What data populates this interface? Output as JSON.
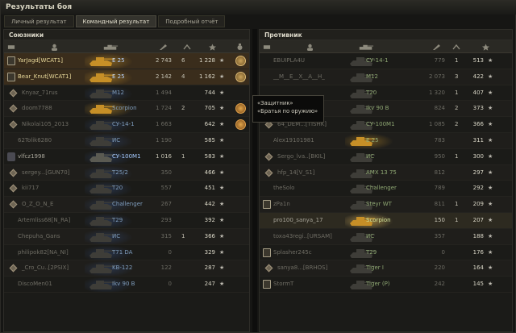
{
  "window": {
    "title": "Результаты боя"
  },
  "tabs": [
    {
      "label": "Личный результат",
      "active": false
    },
    {
      "label": "Командный результат",
      "active": true
    },
    {
      "label": "Подробный отчёт",
      "active": false
    }
  ],
  "allies": {
    "title": "Союзники",
    "rows": [
      {
        "name": "YarJagd[WCAT1]",
        "tank": "E 25",
        "dmg": "2 743",
        "kills": "6",
        "xp": "1 228",
        "mark": "platoon",
        "state": "me",
        "medal": "gear"
      },
      {
        "name": "Bear_Knut[WCAT1]",
        "tank": "E 25",
        "dmg": "2 142",
        "kills": "4",
        "xp": "1 162",
        "mark": "platoon",
        "state": "me",
        "medal": "gear"
      },
      {
        "name": "Knyaz_71rus",
        "tank": "M12",
        "dmg": "1 494",
        "kills": "",
        "xp": "744",
        "mark": "diamond",
        "state": "dead",
        "medal": ""
      },
      {
        "name": "doom7788",
        "tank": "Scorpion",
        "dmg": "1 724",
        "kills": "2",
        "xp": "705",
        "mark": "diamond",
        "state": "dead",
        "medal": "sun"
      },
      {
        "name": "Nikolai105_2013",
        "tank": "СУ-14-1",
        "dmg": "1 663",
        "kills": "",
        "xp": "642",
        "mark": "diamond",
        "state": "dead",
        "medal": "sun"
      },
      {
        "name": "62Tolik6280",
        "tank": "ИС",
        "dmg": "1 190",
        "kills": "",
        "xp": "585",
        "mark": "",
        "state": "dead",
        "medal": ""
      },
      {
        "name": "vlfcz1998",
        "tank": "СУ-100М1",
        "dmg": "1 016",
        "kills": "1",
        "xp": "583",
        "mark": "clan",
        "state": "alive",
        "medal": ""
      },
      {
        "name": "sergey...[GUN70]",
        "tank": "T25/2",
        "dmg": "350",
        "kills": "",
        "xp": "466",
        "mark": "diamond",
        "state": "dead",
        "medal": ""
      },
      {
        "name": "kii717",
        "tank": "T20",
        "dmg": "557",
        "kills": "",
        "xp": "451",
        "mark": "diamond",
        "state": "dead",
        "medal": ""
      },
      {
        "name": "O_Z_O_N_E",
        "tank": "Challenger",
        "dmg": "267",
        "kills": "",
        "xp": "442",
        "mark": "diamond",
        "state": "dead",
        "medal": ""
      },
      {
        "name": "Artemliss68[N_RA]",
        "tank": "T29",
        "dmg": "293",
        "kills": "",
        "xp": "392",
        "mark": "",
        "state": "dead",
        "medal": ""
      },
      {
        "name": "Chepuha_Gans",
        "tank": "ИС",
        "dmg": "315",
        "kills": "1",
        "xp": "366",
        "mark": "",
        "state": "dead",
        "medal": ""
      },
      {
        "name": "philipok82[NA_NI]",
        "tank": "T71 DA",
        "dmg": "0",
        "kills": "",
        "xp": "329",
        "mark": "",
        "state": "dead",
        "medal": ""
      },
      {
        "name": "_Cro_Cu..[2PSIX]",
        "tank": "KB-122",
        "dmg": "122",
        "kills": "",
        "xp": "287",
        "mark": "diamond",
        "state": "dead",
        "medal": ""
      },
      {
        "name": "DiscoMen01",
        "tank": "Ikv 90 B",
        "dmg": "0",
        "kills": "",
        "xp": "247",
        "mark": "",
        "state": "dead",
        "medal": ""
      }
    ]
  },
  "enemies": {
    "title": "Противник",
    "rows": [
      {
        "name": "EBUIPLA4U",
        "tank": "СУ-14-1",
        "dmg": "779",
        "kills": "1",
        "xp": "513",
        "mark": "",
        "state": "dead"
      },
      {
        "name": "__M__E__X__A__H_",
        "tank": "M12",
        "dmg": "2 073",
        "kills": "3",
        "xp": "422",
        "mark": "",
        "state": "dead"
      },
      {
        "name": "",
        "tank": "T20",
        "dmg": "1 320",
        "kills": "1",
        "xp": "407",
        "mark": "",
        "state": "dead"
      },
      {
        "name": "",
        "tank": "Ikv 90 B",
        "dmg": "824",
        "kills": "2",
        "xp": "373",
        "mark": "",
        "state": "dead"
      },
      {
        "name": "64_DEM...[TISHK]",
        "tank": "СУ-100М1",
        "dmg": "1 085",
        "kills": "2",
        "xp": "366",
        "mark": "diamond",
        "state": "dead"
      },
      {
        "name": "Alex19101981",
        "tank": "E 25",
        "dmg": "783",
        "kills": "",
        "xp": "311",
        "mark": "",
        "state": "dead"
      },
      {
        "name": "Sergo_lva..[BKIL]",
        "tank": "ИС",
        "dmg": "950",
        "kills": "1",
        "xp": "300",
        "mark": "diamond",
        "state": "dead"
      },
      {
        "name": "hfp_14[V_S1]",
        "tank": "AMX 13 75",
        "dmg": "812",
        "kills": "",
        "xp": "297",
        "mark": "diamond",
        "state": "dead"
      },
      {
        "name": "theSolo",
        "tank": "Challenger",
        "dmg": "789",
        "kills": "",
        "xp": "292",
        "mark": "",
        "state": "dead"
      },
      {
        "name": "zPa1n",
        "tank": "Steyr WT",
        "dmg": "811",
        "kills": "1",
        "xp": "209",
        "mark": "platoon",
        "state": "dead"
      },
      {
        "name": "pro100_sanya_17",
        "tank": "Scorpion",
        "dmg": "150",
        "kills": "1",
        "xp": "207",
        "mark": "",
        "state": "alive"
      },
      {
        "name": "toxa43regi..[URSAM]",
        "tank": "ИС",
        "dmg": "357",
        "kills": "",
        "xp": "188",
        "mark": "",
        "state": "dead"
      },
      {
        "name": "Splasher245c",
        "tank": "T29",
        "dmg": "0",
        "kills": "",
        "xp": "176",
        "mark": "platoon",
        "state": "dead"
      },
      {
        "name": "sanya8...[BRHOS]",
        "tank": "Tiger I",
        "dmg": "220",
        "kills": "",
        "xp": "164",
        "mark": "diamond",
        "state": "dead"
      },
      {
        "name": "StormT",
        "tank": "Tiger (P)",
        "dmg": "242",
        "kills": "",
        "xp": "145",
        "mark": "platoon",
        "state": "dead"
      }
    ]
  },
  "tooltip": {
    "line1": "«Защитник»",
    "line2": "«Братья по оружию»"
  },
  "star_glyph": "★"
}
